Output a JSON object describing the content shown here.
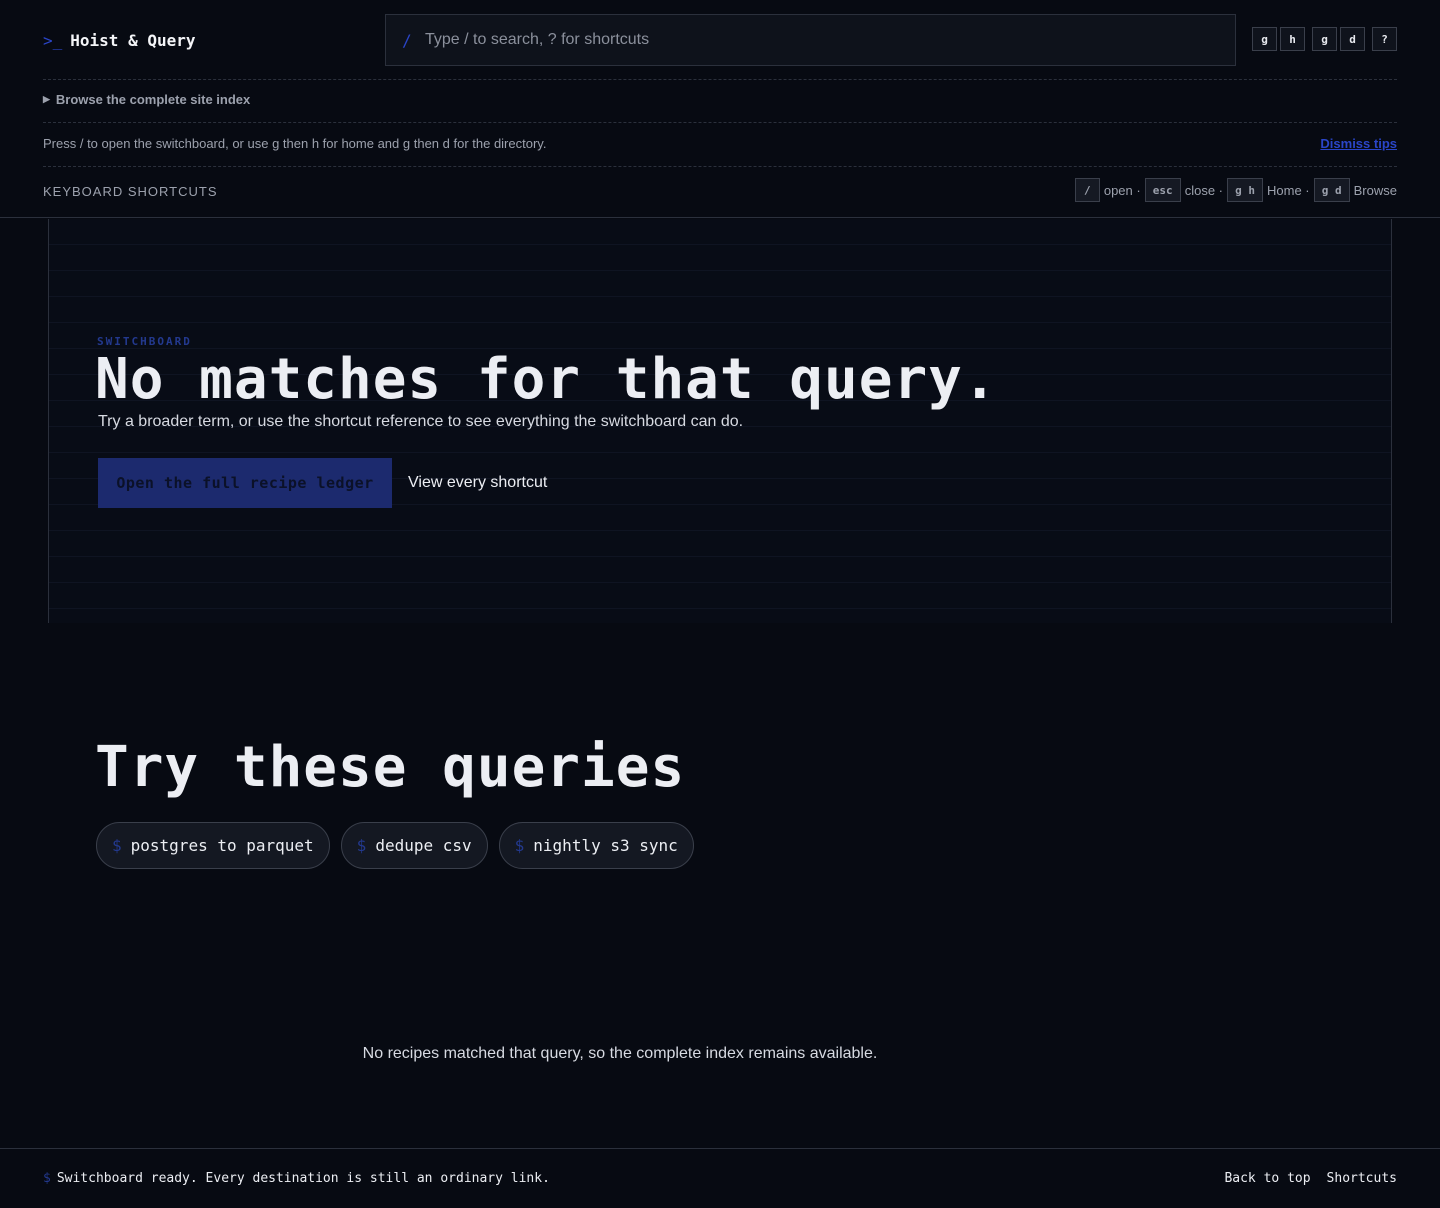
{
  "header": {
    "brand_prompt": ">_",
    "brand_name": "Hoist & Query",
    "search": {
      "slash": "/",
      "placeholder": "Type / to search, ? for shortcuts"
    },
    "keys": [
      "g",
      "h",
      "g",
      "d",
      "?"
    ],
    "site_index_label": "Browse the complete site index",
    "tip_text": "Press / to open the switchboard, or use g then h for home and g then d for the directory.",
    "dismiss_label": "Dismiss tips",
    "shortcuts_label": "KEYBOARD SHORTCUTS",
    "shortcut_ref": [
      {
        "key": "/",
        "label": "open ·"
      },
      {
        "key": "esc",
        "label": "close ·"
      },
      {
        "key": "g h",
        "label": "Home ·"
      },
      {
        "key": "g d",
        "label": "Browse"
      }
    ]
  },
  "hero": {
    "eyebrow": "SWITCHBOARD",
    "title": "No matches for that query.",
    "subtitle": "Try a broader term, or use the shortcut reference to see everything the switchboard can do.",
    "primary_button": "Open the full recipe ledger",
    "secondary_link": "View every shortcut"
  },
  "queries": {
    "title": "Try these queries",
    "chip_prefix": "$",
    "chips": [
      "postgres to parquet",
      "dedupe csv",
      "nightly s3 sync"
    ]
  },
  "empty_note": "No recipes matched that query, so the complete index remains available.",
  "footer": {
    "status_prefix": "$",
    "status_text": "Switchboard ready. Every destination is still an ordinary link.",
    "back_to_top": "Back to top",
    "shortcuts": "Shortcuts"
  },
  "colors": {
    "background": "#070a12",
    "accent": "#2a45c8",
    "primary_button": "#1c2a6e",
    "border": "#2b303c"
  }
}
